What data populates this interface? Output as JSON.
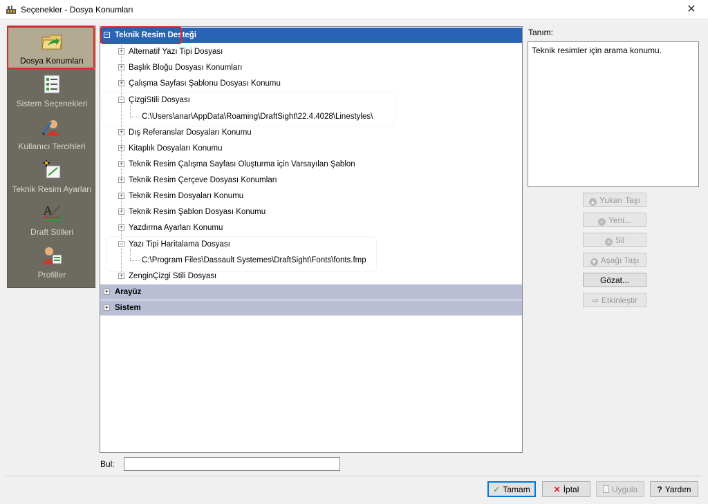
{
  "window": {
    "title": "Seçenekler - Dosya Konumları",
    "close_glyph": "✕"
  },
  "sidebar": {
    "items": [
      {
        "label": "Dosya Konumları",
        "icon": "folder-arrow-icon",
        "active": true
      },
      {
        "label": "Sistem Seçenekleri",
        "icon": "checklist-icon",
        "active": false
      },
      {
        "label": "Kullanıcı Tercihleri",
        "icon": "user-preferences-icon",
        "active": false
      },
      {
        "label": "Teknik Resim Ayarları",
        "icon": "drawing-settings-icon",
        "active": false
      },
      {
        "label": "Draft Stilleri",
        "icon": "text-style-icon",
        "active": false
      },
      {
        "label": "Profiller",
        "icon": "profile-user-icon",
        "active": false
      }
    ]
  },
  "tree": {
    "expand_glyph": "+",
    "collapse_glyph": "−",
    "root": "Teknik Resim Desteği",
    "items": [
      "Alternatif Yazı Tipi Dosyası",
      "Başlık Bloğu Dosyası Konumları",
      "Çalışma Sayfası Şablonu Dosyası Konumu",
      "ÇizgiStili Dosyası",
      "C:\\Users\\anar\\AppData\\Roaming\\DraftSight\\22.4.4028\\Linestyles\\",
      "Dış Referanslar Dosyaları Konumu",
      "Kitaplık Dosyaları Konumu",
      "Teknik Resim Çalışma Sayfası Oluşturma için Varsayılan Şablon",
      "Teknik Resim Çerçeve Dosyası Konumları",
      "Teknik Resim Dosyaları Konumu",
      "Teknik Resim Şablon Dosyası Konumu",
      "Yazdırma Ayarları Konumu",
      "Yazı Tipi Haritalama Dosyası",
      "C:\\Program Files\\Dassault Systemes\\DraftSight\\Fonts\\fonts.fmp",
      "ZenginÇizgi Stili Dosyası"
    ],
    "categories": [
      "Arayüz",
      "Sistem"
    ]
  },
  "description": {
    "label": "Tanım:",
    "text": "Teknik resimler için arama konumu."
  },
  "actions": {
    "move_up": "Yukarı Taşı",
    "new": "Yeni...",
    "delete": "Sil",
    "move_down": "Aşağı Taşı",
    "browse": "Gözat...",
    "activate": "Etkinleştir"
  },
  "find": {
    "label": "Bul:",
    "value": ""
  },
  "footer": {
    "ok": "Tamam",
    "cancel": "İptal",
    "apply": "Uygula",
    "help": "Yardım",
    "ok_glyph": "✓",
    "cancel_glyph": "✕",
    "help_glyph": "?"
  },
  "colors": {
    "selection": "#2a62b5",
    "category_row": "#b9bed4",
    "sidebar_bg": "#6d6a60",
    "sidebar_active": "#b3aa93",
    "highlight_border": "#e0242b"
  }
}
